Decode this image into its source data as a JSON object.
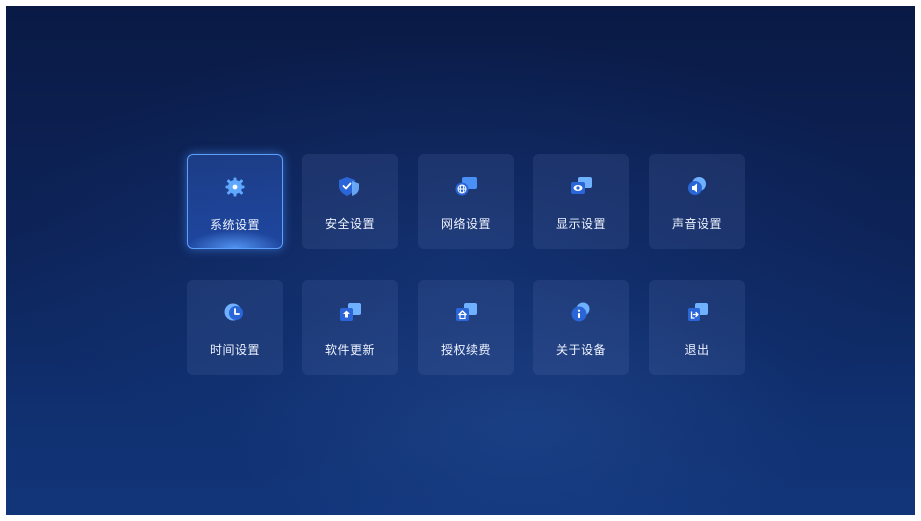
{
  "menu": {
    "row1": [
      {
        "label": "系统设置",
        "icon": "gear-icon",
        "selected": true
      },
      {
        "label": "安全设置",
        "icon": "shield-check-icon",
        "selected": false
      },
      {
        "label": "网络设置",
        "icon": "globe-network-icon",
        "selected": false
      },
      {
        "label": "显示设置",
        "icon": "eye-display-icon",
        "selected": false
      },
      {
        "label": "声音设置",
        "icon": "speaker-icon",
        "selected": false
      }
    ],
    "row2": [
      {
        "label": "时间设置",
        "icon": "clock-icon",
        "selected": false
      },
      {
        "label": "软件更新",
        "icon": "upload-arrow-icon",
        "selected": false
      },
      {
        "label": "授权续费",
        "icon": "license-home-icon",
        "selected": false
      },
      {
        "label": "关于设备",
        "icon": "info-icon",
        "selected": false
      },
      {
        "label": "退出",
        "icon": "exit-icon",
        "selected": false
      }
    ]
  },
  "colors": {
    "accent": "#3d8bff",
    "accent_light": "#6fb0ff",
    "background": "#0d2358",
    "text": "#eef3ff"
  }
}
